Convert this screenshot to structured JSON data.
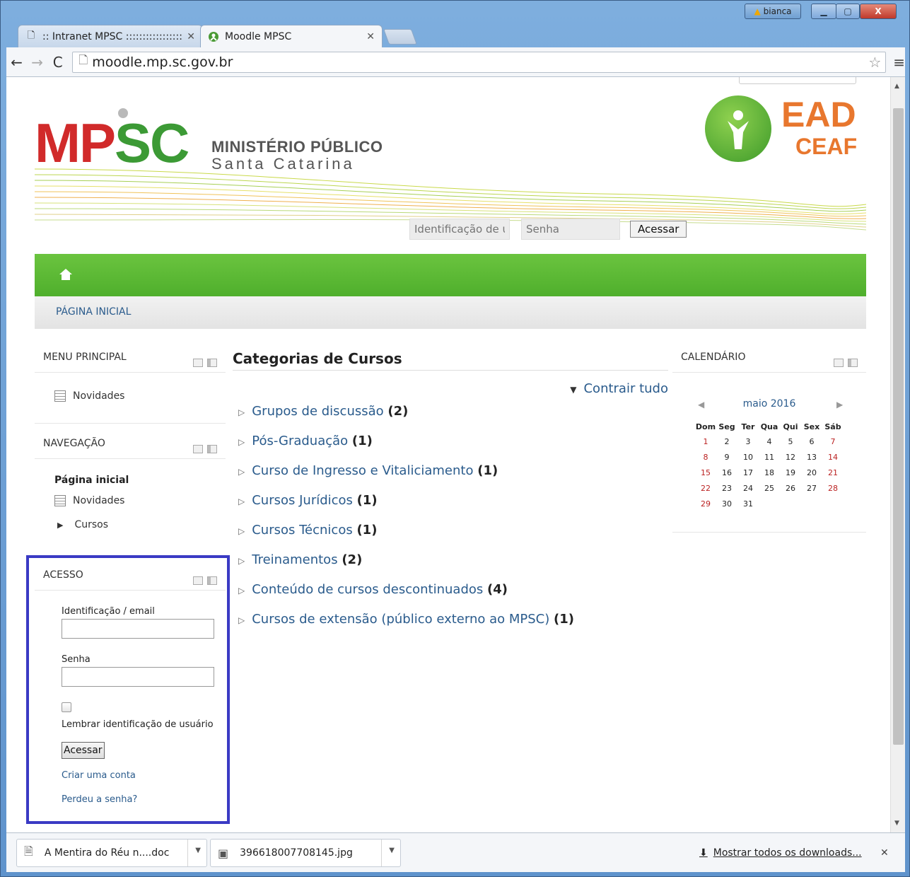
{
  "browser": {
    "tabs": [
      {
        "title": ":: Intranet MPSC :::::::::::::::::",
        "active": false
      },
      {
        "title": "Moodle MPSC",
        "active": true
      }
    ],
    "user_badge": "bianca",
    "url": "moodle.mp.sc.gov.br"
  },
  "header": {
    "logo_letters": "MPSC",
    "logo_line1": "MINISTÉRIO PÚBLICO",
    "logo_line2": "Santa Catarina",
    "ead_title": "EAD",
    "ead_subtitle": "CEAF",
    "login": {
      "user_placeholder": "Identificação de usuário",
      "pass_placeholder": "Senha",
      "button": "Acessar"
    }
  },
  "breadcrumb": "PÁGINA INICIAL",
  "menu_principal": {
    "title": "MENU PRINCIPAL",
    "items": [
      "Novidades"
    ]
  },
  "navegacao": {
    "title": "NAVEGAÇÃO",
    "home": "Página inicial",
    "items": [
      "Novidades",
      "Cursos"
    ]
  },
  "acesso": {
    "title": "ACESSO",
    "user_label": "Identificação / email",
    "pass_label": "Senha",
    "remember_label": "Lembrar identificação de usuário",
    "button": "Acessar",
    "create_account": "Criar uma conta",
    "lost_password": "Perdeu a senha?"
  },
  "categories": {
    "title": "Categorias de Cursos",
    "collapse_all": "Contrair tudo",
    "items": [
      {
        "name": "Grupos de discussão",
        "count": "(2)"
      },
      {
        "name": "Pós-Graduação",
        "count": "(1)"
      },
      {
        "name": "Curso de Ingresso e Vitaliciamento",
        "count": "(1)"
      },
      {
        "name": "Cursos Jurídicos",
        "count": "(1)"
      },
      {
        "name": "Cursos Técnicos",
        "count": "(1)"
      },
      {
        "name": "Treinamentos",
        "count": "(2)"
      },
      {
        "name": "Conteúdo de cursos descontinuados",
        "count": "(4)"
      },
      {
        "name": "Cursos de extensão (público externo ao MPSC)",
        "count": "(1)"
      }
    ]
  },
  "calendar": {
    "title": "CALENDÁRIO",
    "month": "maio 2016",
    "weekdays": [
      "Dom",
      "Seg",
      "Ter",
      "Qua",
      "Qui",
      "Sex",
      "Sáb"
    ],
    "weeks": [
      [
        "1",
        "2",
        "3",
        "4",
        "5",
        "6",
        "7"
      ],
      [
        "8",
        "9",
        "10",
        "11",
        "12",
        "13",
        "14"
      ],
      [
        "15",
        "16",
        "17",
        "18",
        "19",
        "20",
        "21"
      ],
      [
        "22",
        "23",
        "24",
        "25",
        "26",
        "27",
        "28"
      ],
      [
        "29",
        "30",
        "31",
        "",
        "",
        "",
        ""
      ]
    ]
  },
  "downloads": {
    "items": [
      "A Mentira do Réu n....doc",
      "396618007708145.jpg"
    ],
    "show_all": "Mostrar todos os downloads..."
  },
  "colors": {
    "green_bar": "#5bb834",
    "link": "#2a5b8c",
    "highlight_frame": "#3a3ac4",
    "logo_red": "#d12a2a",
    "logo_green": "#3c9a35",
    "ead_orange": "#e8772e"
  }
}
